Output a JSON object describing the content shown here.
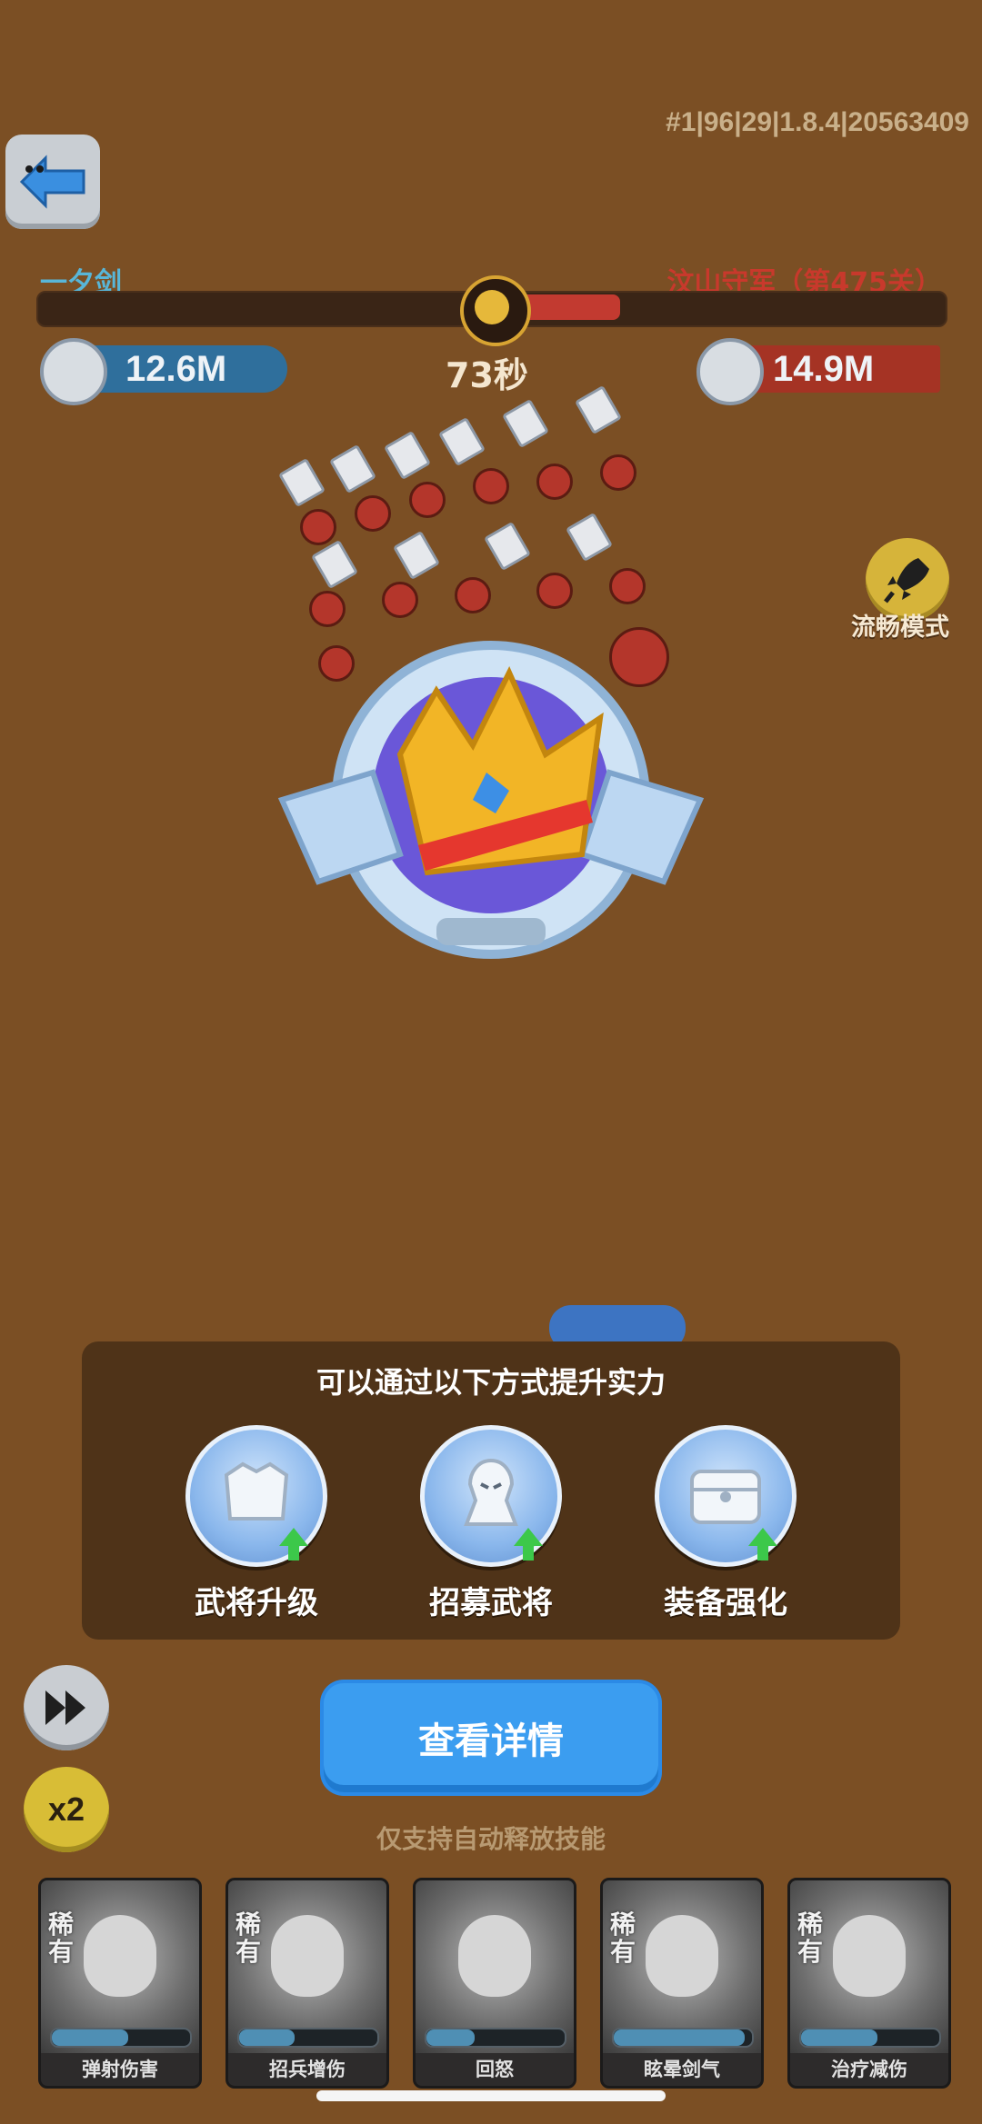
{
  "header": {
    "version": "#1|96|29|1.8.4|20563409",
    "player_name": "一夕剑",
    "enemy_name": "汶山守军（第475关）",
    "player_power": "12.6M",
    "enemy_power": "14.9M",
    "timer": "73秒",
    "enemy_health_fraction": 0.14
  },
  "smooth_mode": {
    "label": "流畅模式"
  },
  "hint_panel": {
    "title": "可以通过以下方式提升实力",
    "options": [
      {
        "label": "武将升级",
        "icon": "armor-upgrade-icon"
      },
      {
        "label": "招募武将",
        "icon": "recruit-icon"
      },
      {
        "label": "装备强化",
        "icon": "chest-upgrade-icon"
      }
    ]
  },
  "controls": {
    "speed_label": "x2",
    "detail_button": "查看详情",
    "auto_note": "仅支持自动释放技能"
  },
  "heroes": [
    {
      "rarity": "稀有",
      "skill": "弹射伤害",
      "energy": 0.55
    },
    {
      "rarity": "稀有",
      "skill": "招兵增伤",
      "energy": 0.4
    },
    {
      "rarity": "",
      "skill": "回怒",
      "energy": 0.35
    },
    {
      "rarity": "稀有",
      "skill": "眩晕剑气",
      "energy": 0.95
    },
    {
      "rarity": "稀有",
      "skill": "治疗减伤",
      "energy": 0.55
    }
  ],
  "colors": {
    "background": "#7b4f24",
    "player": "#2f6f9c",
    "enemy": "#a53324",
    "button": "#3b9df0"
  }
}
